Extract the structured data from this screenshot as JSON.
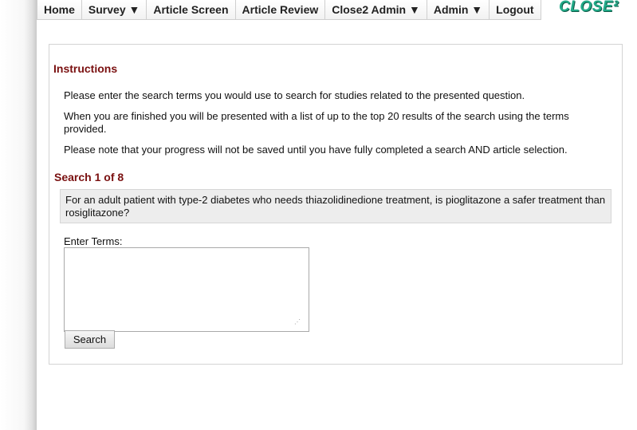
{
  "nav": {
    "items": [
      {
        "label": "Home"
      },
      {
        "label": "Survey ▼"
      },
      {
        "label": "Article Screen"
      },
      {
        "label": "Article Review"
      },
      {
        "label": "Close2 Admin ▼"
      },
      {
        "label": "Admin ▼"
      },
      {
        "label": "Logout"
      }
    ],
    "logo_text": "CLOSE²"
  },
  "instructions": {
    "heading": "Instructions",
    "paragraphs": [
      "Please enter the search terms you would use to search for studies related to the presented question.",
      "When you are finished you will be presented with a list of up to the top 20 results of the search using the terms provided.",
      "Please note that your progress will not be saved until you have fully completed a search AND article selection."
    ]
  },
  "search": {
    "heading": "Search 1 of 8",
    "question": "For an adult patient with type-2 diabetes who needs thiazolidinedione treatment, is pioglitazone a safer treatment than rosiglitazone?",
    "terms_label": "Enter Terms:",
    "terms_value": "",
    "button_label": "Search"
  },
  "colors": {
    "heading": "#7a1010",
    "logo": "#22aa88"
  }
}
